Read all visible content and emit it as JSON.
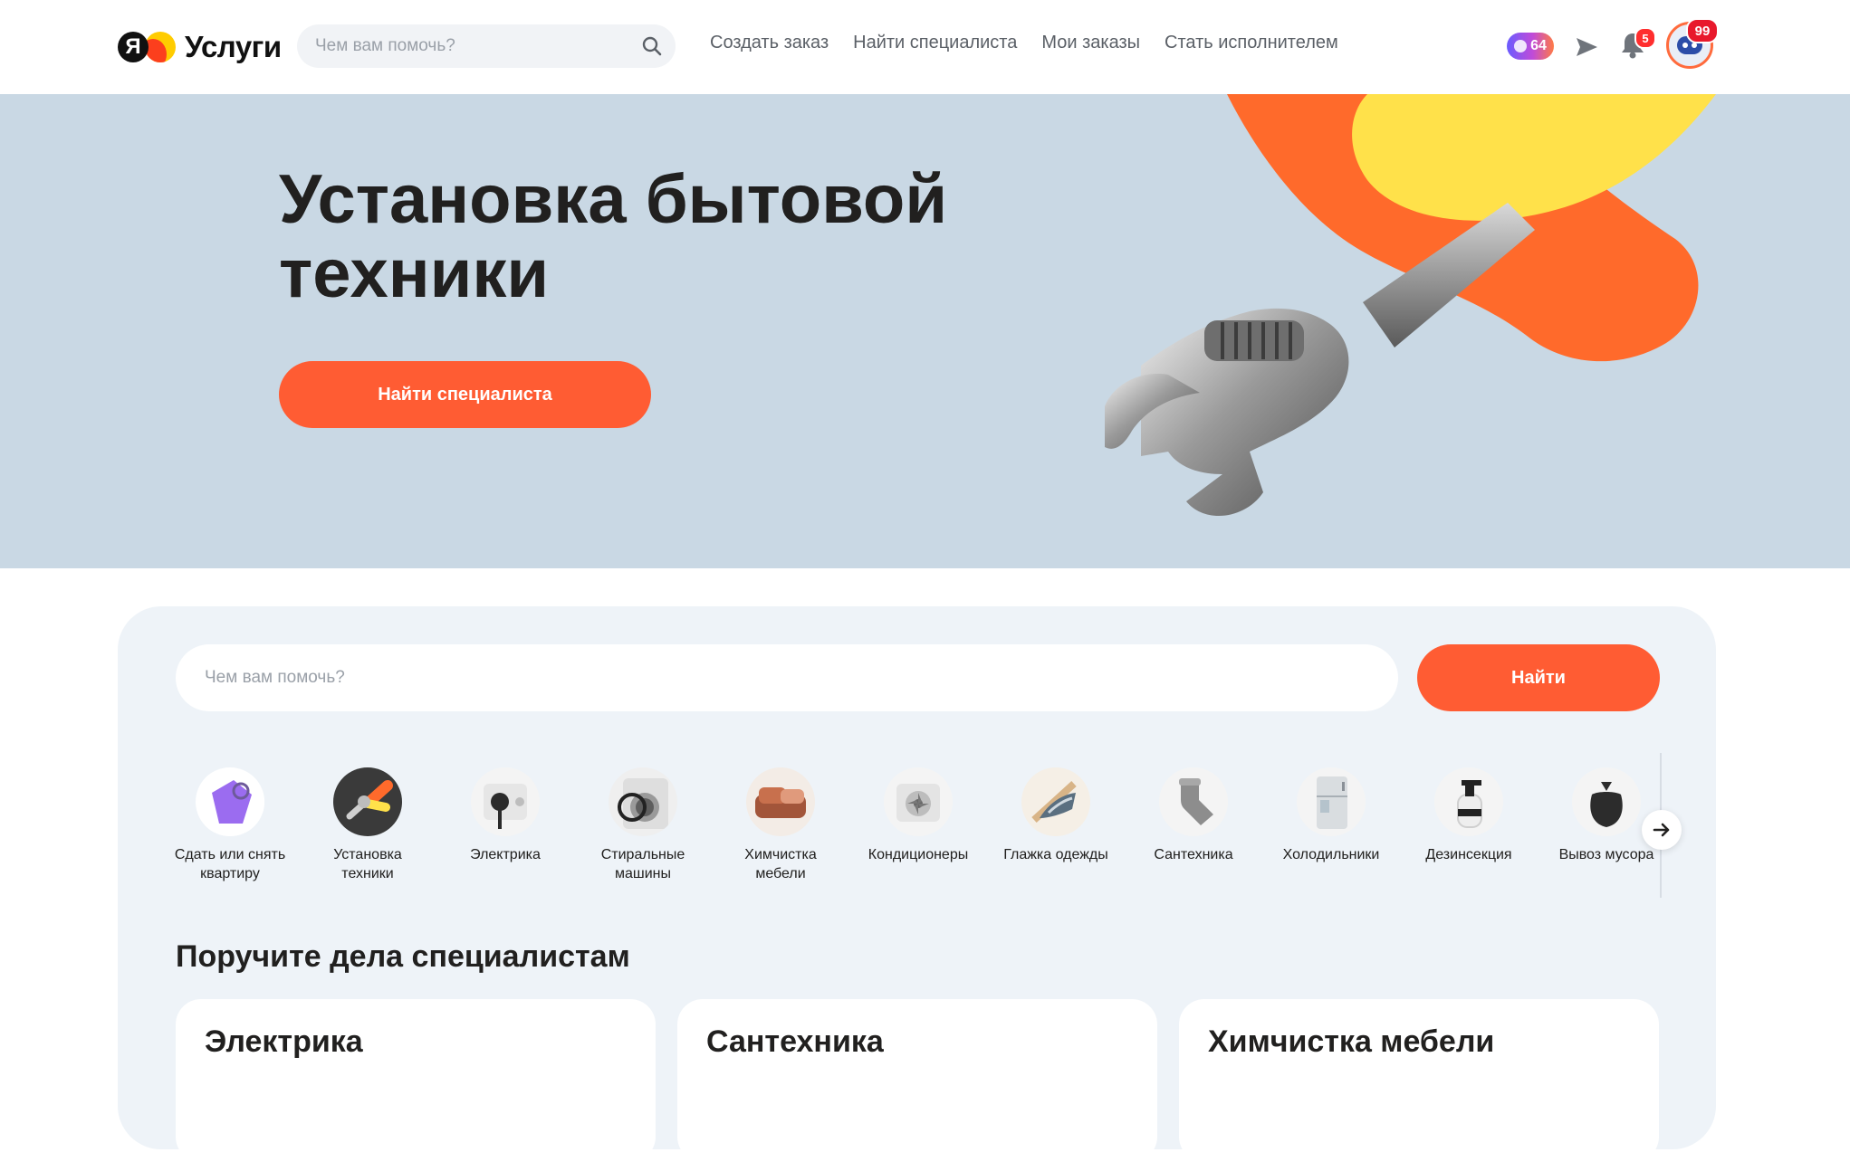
{
  "header": {
    "logo_mark": "Я",
    "logo_text": "Услуги",
    "search_placeholder": "Чем вам помочь?",
    "nav": [
      "Создать заказ",
      "Найти специалиста",
      "Мои заказы",
      "Стать исполнителем"
    ],
    "plus_points": "64",
    "notifications_count": "5",
    "avatar_badge": "99"
  },
  "hero": {
    "title": "Установка бытовой техники",
    "button": "Найти специалиста"
  },
  "search": {
    "placeholder": "Чем вам помочь?",
    "button": "Найти"
  },
  "categories": [
    {
      "label": "Сдать или снять\nквартиру",
      "icon": "key-fob-icon"
    },
    {
      "label": "Установка\nтехники",
      "icon": "wrench-icon"
    },
    {
      "label": "Электрика",
      "icon": "power-socket-icon"
    },
    {
      "label": "Стиральные\nмашины",
      "icon": "washing-machine-icon"
    },
    {
      "label": "Химчистка\nмебели",
      "icon": "sofa-icon"
    },
    {
      "label": "Кондиционеры",
      "icon": "air-conditioner-icon"
    },
    {
      "label": "Глажка одежды",
      "icon": "iron-icon"
    },
    {
      "label": "Сантехника",
      "icon": "pipe-icon"
    },
    {
      "label": "Холодильники",
      "icon": "fridge-icon"
    },
    {
      "label": "Дезинсекция",
      "icon": "sprayer-icon"
    },
    {
      "label": "Вывоз мусора",
      "icon": "trash-bag-icon"
    }
  ],
  "section": {
    "title": "Поручите дела специалистам",
    "cards": [
      "Электрика",
      "Сантехника",
      "Химчистка мебели"
    ]
  },
  "colors": {
    "accent": "#ff5c33",
    "hero_bg": "#c9d8e4",
    "panel_bg": "#eef3f8"
  }
}
